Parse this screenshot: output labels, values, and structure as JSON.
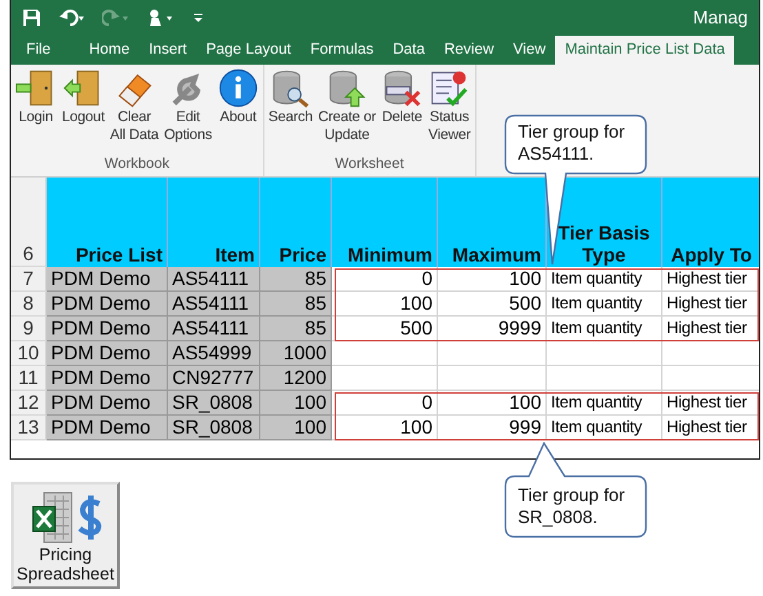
{
  "window": {
    "title": "Manag"
  },
  "tabs": [
    {
      "label": "File",
      "selected": false
    },
    {
      "label": "Home",
      "selected": false
    },
    {
      "label": "Insert",
      "selected": false
    },
    {
      "label": "Page Layout",
      "selected": false
    },
    {
      "label": "Formulas",
      "selected": false
    },
    {
      "label": "Data",
      "selected": false
    },
    {
      "label": "Review",
      "selected": false
    },
    {
      "label": "View",
      "selected": false
    },
    {
      "label": "Maintain Price List Data",
      "selected": true
    }
  ],
  "ribbon": {
    "groups": [
      {
        "label": "Workbook",
        "buttons": [
          {
            "kind": "login",
            "lines": [
              "Login"
            ]
          },
          {
            "kind": "logout",
            "lines": [
              "Logout"
            ]
          },
          {
            "kind": "clear",
            "lines": [
              "Clear",
              "All Data"
            ]
          },
          {
            "kind": "edit",
            "lines": [
              "Edit",
              "Options"
            ]
          },
          {
            "kind": "about",
            "lines": [
              "About"
            ]
          }
        ]
      },
      {
        "label": "Worksheet",
        "buttons": [
          {
            "kind": "search",
            "lines": [
              "Search"
            ]
          },
          {
            "kind": "create",
            "lines": [
              "Create or",
              "Update"
            ]
          },
          {
            "kind": "delete",
            "lines": [
              "Delete"
            ]
          },
          {
            "kind": "status",
            "lines": [
              "Status",
              "Viewer"
            ]
          }
        ]
      }
    ]
  },
  "sheet": {
    "header": {
      "row_number": "6",
      "columns": [
        "Price List",
        "Item",
        "Price",
        "Minimum",
        "Maximum",
        "Tier Basis Type",
        "Apply To"
      ]
    },
    "row_groups": [
      {
        "kind": "tier",
        "rows": [
          {
            "row_number": "7",
            "cells": [
              "PDM Demo",
              "AS54111",
              "85",
              "0",
              "100",
              "Item quantity",
              "Highest tier"
            ]
          },
          {
            "row_number": "8",
            "cells": [
              "PDM Demo",
              "AS54111",
              "85",
              "100",
              "500",
              "Item quantity",
              "Highest tier"
            ]
          },
          {
            "row_number": "9",
            "cells": [
              "PDM Demo",
              "AS54111",
              "85",
              "500",
              "9999",
              "Item quantity",
              "Highest tier"
            ]
          }
        ]
      },
      {
        "kind": "plain",
        "rows": [
          {
            "row_number": "10",
            "cells": [
              "PDM Demo",
              "AS54999",
              "1000"
            ]
          },
          {
            "row_number": "11",
            "cells": [
              "PDM Demo",
              "CN92777",
              "1200"
            ]
          }
        ]
      },
      {
        "kind": "tier",
        "rows": [
          {
            "row_number": "12",
            "cells": [
              "PDM Demo",
              "SR_0808",
              "100",
              "0",
              "100",
              "Item quantity",
              "Highest tier"
            ]
          },
          {
            "row_number": "13",
            "cells": [
              "PDM Demo",
              "SR_0808",
              "100",
              "100",
              "999",
              "Item quantity",
              "Highest tier"
            ]
          }
        ]
      }
    ]
  },
  "callouts": [
    {
      "kind": "down",
      "text": "Tier group for AS54111."
    },
    {
      "kind": "up",
      "text": "Tier group for SR_0808."
    }
  ],
  "launcher": {
    "label": "Pricing Spreadsheet"
  }
}
